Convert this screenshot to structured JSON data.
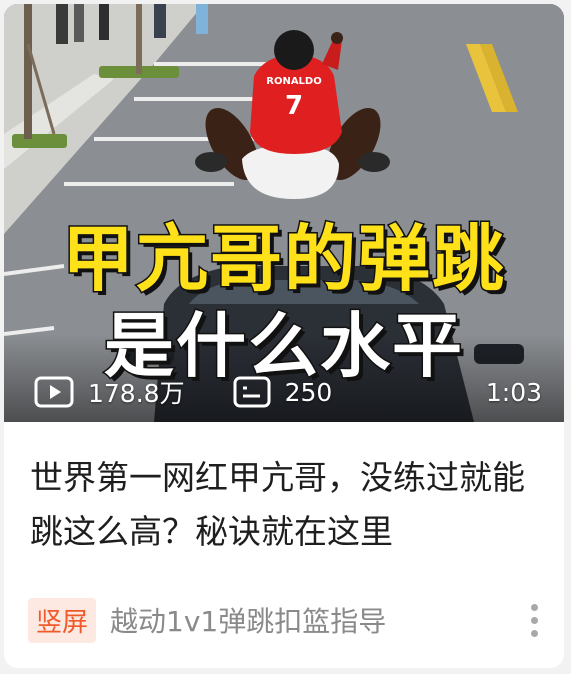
{
  "video": {
    "overlay_line1": "甲亢哥的弹跳",
    "overlay_line2": "是什么水平",
    "jersey_text": "RONALDO",
    "jersey_number": "7",
    "views": "178.8万",
    "comments": "250",
    "duration": "1:03"
  },
  "title": "世界第一网红甲亢哥，没练过就能跳这么高？秘诀就在这里",
  "tag": "竖屏",
  "channel": "越动1v1弹跳扣篮指导",
  "icons": {
    "views": "play-icon",
    "comments": "comment-icon",
    "more": "more-vertical-icon"
  },
  "colors": {
    "overlay_yellow": "#ffe11a",
    "tag_text": "#f05a2a",
    "tag_bg": "#fde9e2",
    "jersey_red": "#e02020"
  }
}
